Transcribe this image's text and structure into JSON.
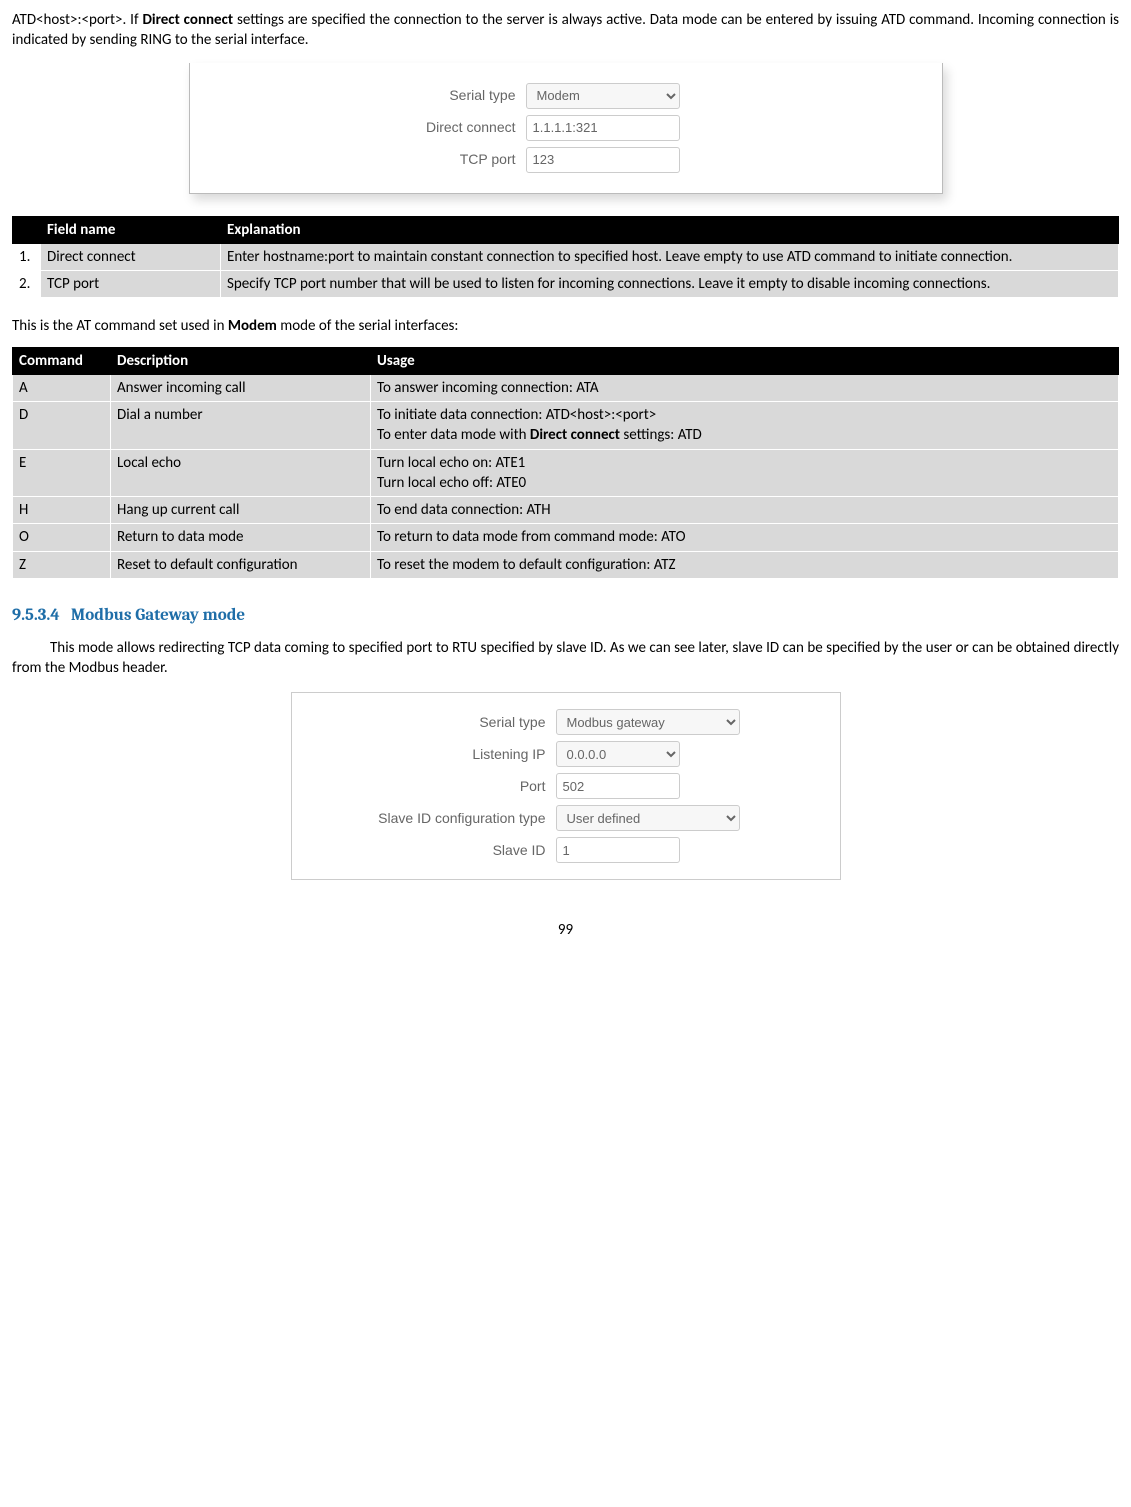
{
  "intro": {
    "line1_pre": "ATD<host>:<port>. If ",
    "line1_bold": "Direct connect",
    "line1_post": " settings are specified the connection to the server is always active. Data mode can be entered by issuing ATD command. Incoming connection is indicated by sending RING to the serial interface."
  },
  "form1": {
    "serial_type_label": "Serial type",
    "serial_type_value": "Modem",
    "direct_connect_label": "Direct connect",
    "direct_connect_value": "1.1.1.1:321",
    "tcp_port_label": "TCP port",
    "tcp_port_value": "123"
  },
  "table1": {
    "headers": {
      "col1": "",
      "col2": "Field name",
      "col3": "Explanation"
    },
    "rows": [
      {
        "n": "1.",
        "field": "Direct connect",
        "exp": "Enter hostname:port to maintain constant connection to specified host. Leave empty to use ATD command to initiate connection."
      },
      {
        "n": "2.",
        "field": "TCP port",
        "exp": "Specify TCP port number that will be used to listen for incoming connections. Leave it empty to disable incoming connections."
      }
    ]
  },
  "mid_text": {
    "pre": "This is the AT command set used in ",
    "bold": "Modem",
    "post": " mode of the serial interfaces:"
  },
  "table2": {
    "headers": {
      "c1": "Command",
      "c2": "Description",
      "c3": "Usage"
    },
    "rows": [
      {
        "cmd": "A",
        "desc": "Answer incoming call",
        "usage_plain": "To answer incoming connection: ATA"
      },
      {
        "cmd": "D",
        "desc": "Dial a number",
        "usage_l1": "To initiate data connection: ATD<host>:<port>",
        "usage_l2_pre": "To enter data mode with ",
        "usage_l2_bold": "Direct connect",
        "usage_l2_post": " settings: ATD"
      },
      {
        "cmd": "E",
        "desc": "Local echo",
        "usage_l1": "Turn local echo on: ATE1",
        "usage_l2": "Turn local echo off: ATE0"
      },
      {
        "cmd": "H",
        "desc": "Hang up current call",
        "usage_plain": "To end data connection: ATH"
      },
      {
        "cmd": "O",
        "desc": "Return to data mode",
        "usage_plain": "To return to data mode from command mode: ATO"
      },
      {
        "cmd": "Z",
        "desc": "Reset to default configuration",
        "usage_plain": "To reset the modem to default configuration: ATZ"
      }
    ]
  },
  "section": {
    "num": "9.5.3.4",
    "title": "Modbus Gateway mode",
    "body": "This mode allows redirecting TCP data coming to specified port to RTU specified by slave ID. As we can see later, slave ID can be specified by the user or can be obtained directly from the Modbus header."
  },
  "form2": {
    "serial_type_label": "Serial type",
    "serial_type_value": "Modbus gateway",
    "listening_ip_label": "Listening IP",
    "listening_ip_value": "0.0.0.0",
    "port_label": "Port",
    "port_value": "502",
    "slave_cfg_label": "Slave ID configuration type",
    "slave_cfg_value": "User defined",
    "slave_id_label": "Slave ID",
    "slave_id_value": "1"
  },
  "page_number": "99"
}
